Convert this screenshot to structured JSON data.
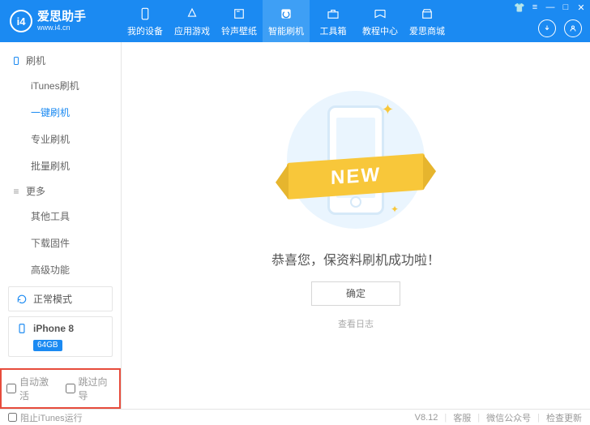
{
  "header": {
    "logo_text": "爱思助手",
    "logo_url": "www.i4.cn",
    "logo_badge": "i4",
    "nav": [
      {
        "label": "我的设备",
        "icon": "device"
      },
      {
        "label": "应用游戏",
        "icon": "apps"
      },
      {
        "label": "铃声壁纸",
        "icon": "media"
      },
      {
        "label": "智能刷机",
        "icon": "flash",
        "active": true
      },
      {
        "label": "工具箱",
        "icon": "toolbox"
      },
      {
        "label": "教程中心",
        "icon": "tutorial"
      },
      {
        "label": "爱思商城",
        "icon": "shop"
      }
    ]
  },
  "sidebar": {
    "sections": [
      {
        "title": "刷机",
        "icon": "phone",
        "items": [
          {
            "label": "iTunes刷机"
          },
          {
            "label": "一键刷机",
            "active": true
          },
          {
            "label": "专业刷机"
          },
          {
            "label": "批量刷机"
          }
        ]
      },
      {
        "title": "更多",
        "icon": "more",
        "items": [
          {
            "label": "其他工具"
          },
          {
            "label": "下载固件"
          },
          {
            "label": "高级功能"
          }
        ]
      }
    ],
    "mode_block": {
      "label": "正常模式"
    },
    "device_block": {
      "name": "iPhone 8",
      "storage": "64GB"
    },
    "options": {
      "auto_activate": "自动激活",
      "skip_wizard": "跳过向导"
    }
  },
  "main": {
    "ribbon_text": "NEW",
    "success_title": "恭喜您，保资料刷机成功啦！",
    "ok_button": "确定",
    "view_log": "查看日志"
  },
  "footer": {
    "block_itunes": "阻止iTunes运行",
    "version": "V8.12",
    "support": "客服",
    "wechat": "微信公众号",
    "check_update": "检查更新"
  }
}
